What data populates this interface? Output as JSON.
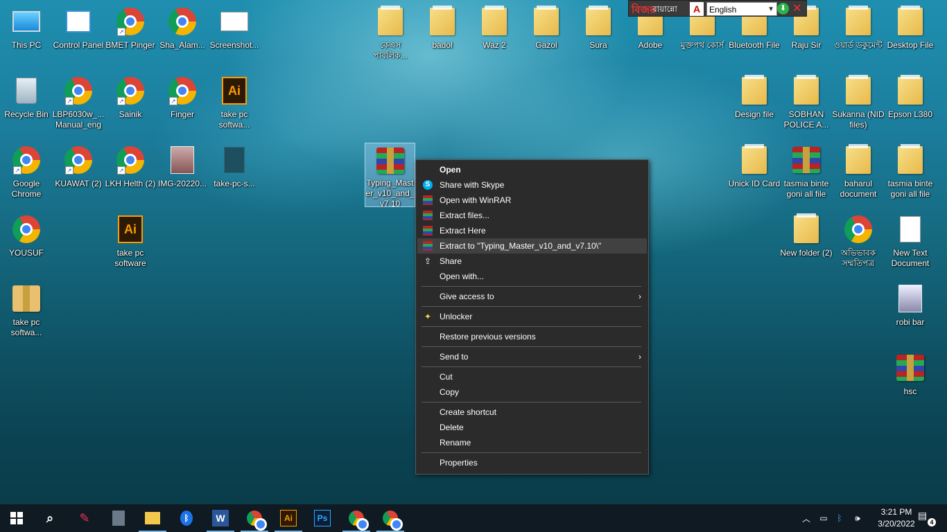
{
  "desktop": {
    "icons": [
      {
        "label": "This PC",
        "icon": "pc-icon"
      },
      {
        "label": "Control Panel",
        "icon": "control-panel-icon"
      },
      {
        "label": "BMET Pinger",
        "icon": "chrome-icon"
      },
      {
        "label": "Sha_Alam...",
        "icon": "chrome-icon"
      },
      {
        "label": "Screenshot...",
        "icon": "image-file-icon"
      },
      {
        "label": "Recycle Bin",
        "icon": "recycle-bin-icon"
      },
      {
        "label": "LBP6030w_... Manual_eng",
        "icon": "chrome-icon"
      },
      {
        "label": "Sainik",
        "icon": "chrome-icon"
      },
      {
        "label": "Finger",
        "icon": "chrome-icon"
      },
      {
        "label": "take pc softwa...",
        "icon": "illustrator-file-icon"
      },
      {
        "label": "Google Chrome",
        "icon": "chrome-icon"
      },
      {
        "label": "KUAWAT (2)",
        "icon": "chrome-icon"
      },
      {
        "label": "LKH Helth (2)",
        "icon": "chrome-icon"
      },
      {
        "label": "IMG-20220...",
        "icon": "photo-icon"
      },
      {
        "label": "take-pc-s...",
        "icon": "file-icon"
      },
      {
        "label": "YOUSUF",
        "icon": "chrome-icon"
      },
      {
        "label": "take pc software",
        "icon": "illustrator-file-icon"
      },
      {
        "label": "take pc softwa...",
        "icon": "app-icon"
      },
      {
        "label": "কেএস পাবলিক...",
        "icon": "folder-icon"
      },
      {
        "label": "badol",
        "icon": "folder-icon"
      },
      {
        "label": "Waz 2",
        "icon": "folder-icon"
      },
      {
        "label": "Gazol",
        "icon": "folder-icon"
      },
      {
        "label": "Sura",
        "icon": "folder-icon"
      },
      {
        "label": "Adobe",
        "icon": "folder-icon"
      },
      {
        "label": "মুক্তপথ কোর্স",
        "icon": "folder-icon"
      },
      {
        "label": "Bluetooth File",
        "icon": "folder-icon"
      },
      {
        "label": "Raju Sir",
        "icon": "folder-icon"
      },
      {
        "label": "ওয়ার্ড ডকুমেন্ট",
        "icon": "folder-icon"
      },
      {
        "label": "Desktop File",
        "icon": "folder-icon"
      },
      {
        "label": "Design file",
        "icon": "folder-icon"
      },
      {
        "label": "SOBHAN POLICE A...",
        "icon": "folder-icon"
      },
      {
        "label": "Sukanna (NID files)",
        "icon": "folder-icon"
      },
      {
        "label": "Epson L380",
        "icon": "folder-icon"
      },
      {
        "label": "Unick ID Card",
        "icon": "folder-icon"
      },
      {
        "label": "tasmia binte goni all file",
        "icon": "winrar-icon"
      },
      {
        "label": "baharul document",
        "icon": "folder-icon"
      },
      {
        "label": "tasmia binte goni all file",
        "icon": "folder-icon"
      },
      {
        "label": "New folder (2)",
        "icon": "folder-icon"
      },
      {
        "label": "অভিভাবক সম্মতিপত্র",
        "icon": "chrome-icon"
      },
      {
        "label": "New Text Document",
        "icon": "text-document-icon"
      },
      {
        "label": "robi bar",
        "icon": "photo-icon"
      },
      {
        "label": "hsc",
        "icon": "winrar-icon"
      },
      {
        "label": "Typing_Master_v10_and_v7.10",
        "icon": "winrar-icon"
      }
    ]
  },
  "language_bar": {
    "bangla_logo": "বিজয়",
    "bangla_label": "বায়ান্নো",
    "selected_language": "English"
  },
  "context_menu": {
    "items": {
      "open": "Open",
      "share_skype": "Share with Skype",
      "open_winrar": "Open with WinRAR",
      "extract_files": "Extract files...",
      "extract_here": "Extract Here",
      "extract_to": "Extract to \"Typing_Master_v10_and_v7.10\\\"",
      "share": "Share",
      "open_with": "Open with...",
      "give_access": "Give access to",
      "unlocker": "Unlocker",
      "restore_versions": "Restore previous versions",
      "send_to": "Send to",
      "cut": "Cut",
      "copy": "Copy",
      "create_shortcut": "Create shortcut",
      "delete": "Delete",
      "rename": "Rename",
      "properties": "Properties"
    }
  },
  "taskbar": {
    "time": "3:21 PM",
    "date": "3/20/2022",
    "notification_count": "4"
  }
}
